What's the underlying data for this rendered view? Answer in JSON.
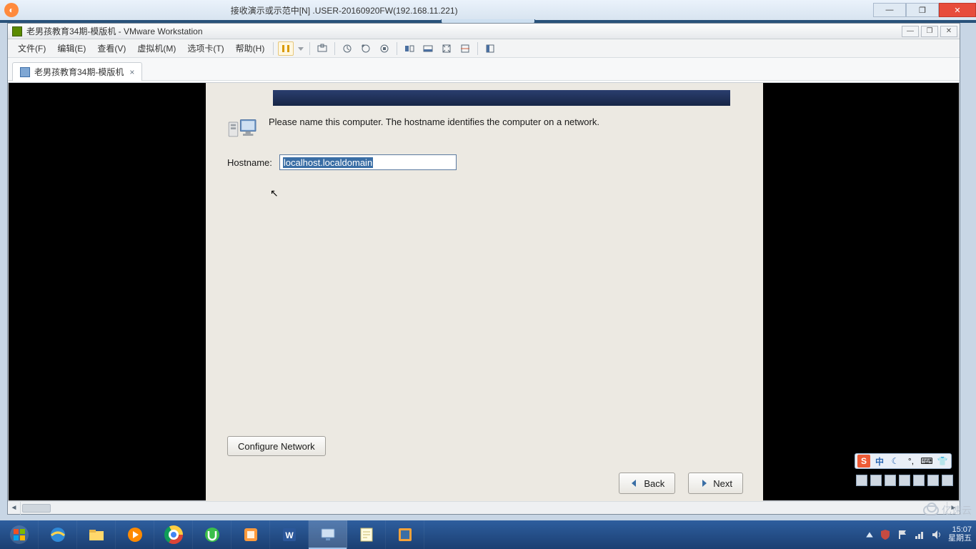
{
  "outer_window": {
    "title": "接收演示或示范中[N] .USER-20160920FW(192.168.11.221)",
    "controls": {
      "min": "—",
      "max": "❐",
      "close": "✕"
    }
  },
  "vmware": {
    "title": "老男孩教育34期-模版机 - VMware Workstation",
    "controls": {
      "min": "—",
      "max": "❐",
      "close": "✕"
    },
    "menu": {
      "file": "文件(F)",
      "edit": "编辑(E)",
      "view": "查看(V)",
      "vm": "虚拟机(M)",
      "tabs": "选项卡(T)",
      "help": "帮助(H)"
    },
    "tab": {
      "label": "老男孩教育34期-模版机",
      "close": "×"
    }
  },
  "installer": {
    "message": "Please name this computer.  The hostname identifies the computer on a network.",
    "hostname_label": "Hostname:",
    "hostname_value": "localhost.localdomain",
    "configure_network": "Configure Network",
    "back": "Back",
    "next": "Next"
  },
  "ime": {
    "engine": "S",
    "lang": "中"
  },
  "taskbar": {
    "time": "15:07",
    "date_label": "星期五"
  },
  "watermark": "亿速云"
}
